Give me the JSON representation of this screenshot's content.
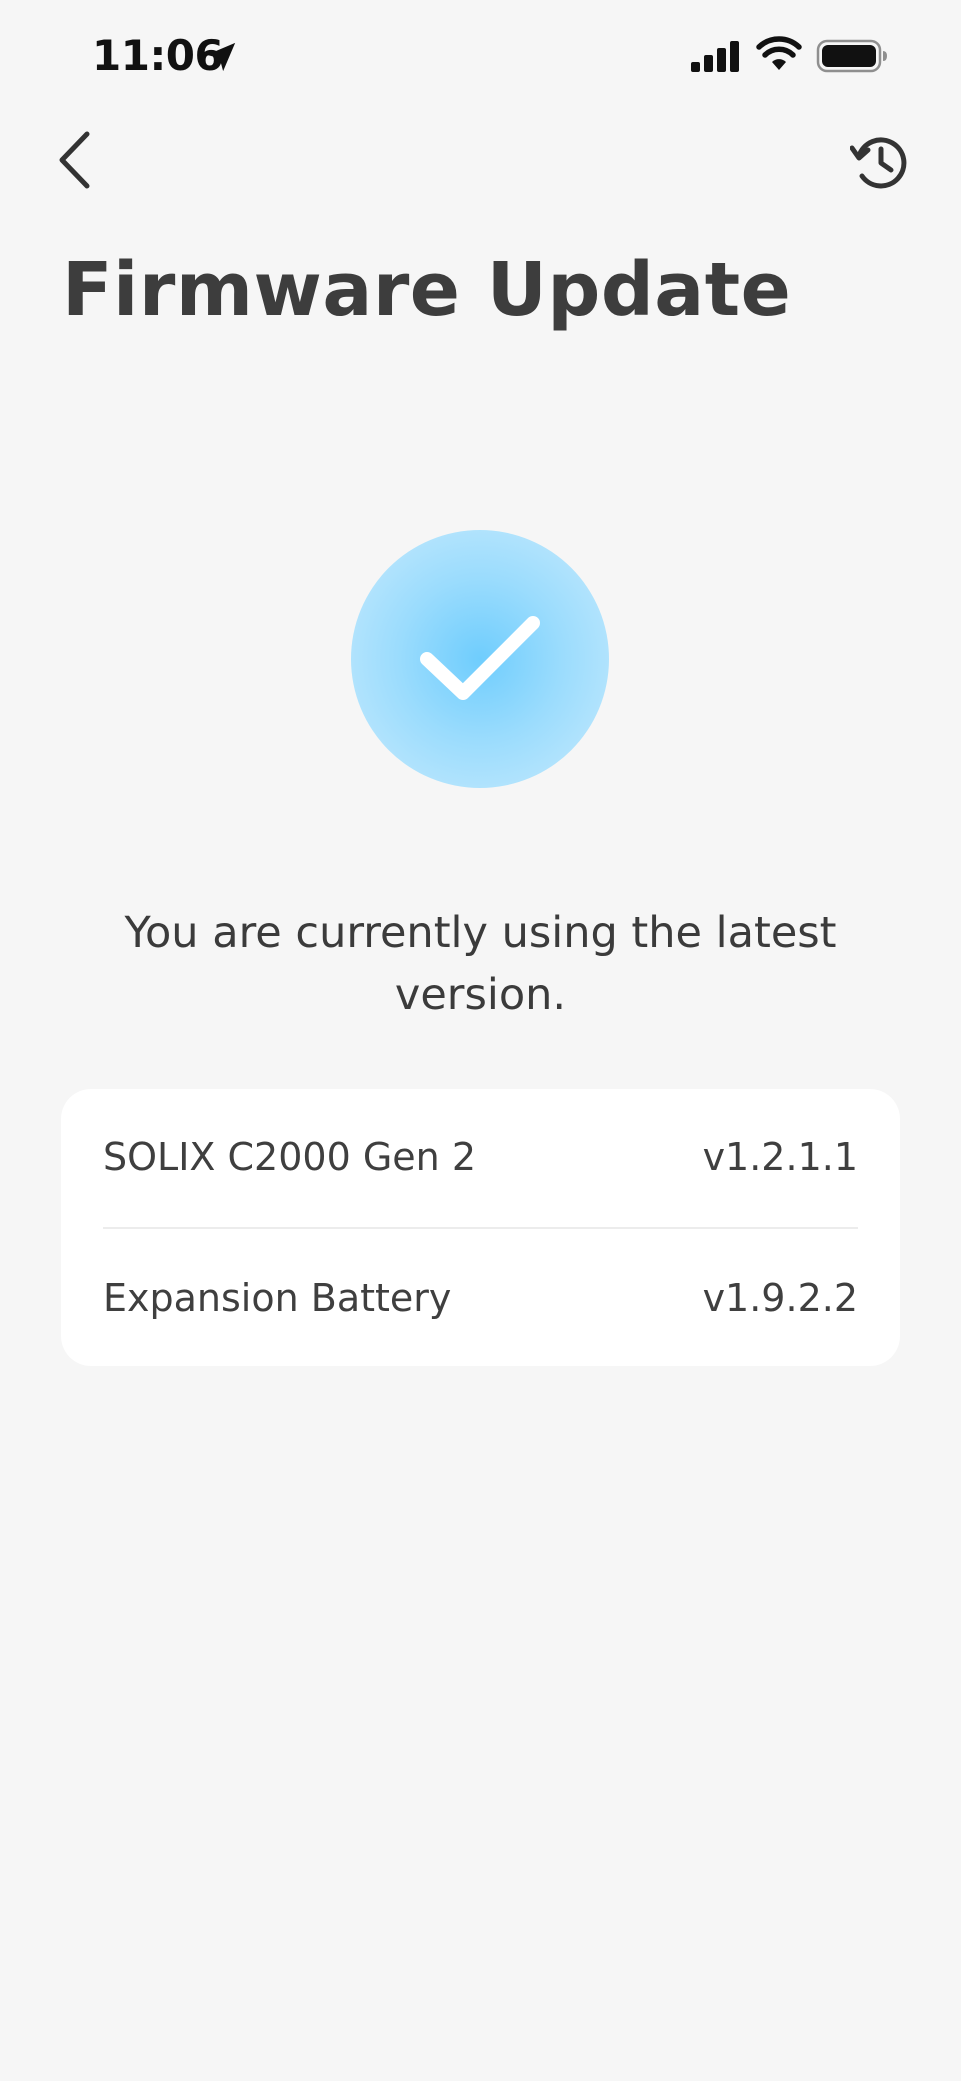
{
  "status_bar": {
    "time": "11:06",
    "location_icon": "location-arrow-icon",
    "signal_icon": "cellular-signal-icon",
    "wifi_icon": "wifi-icon",
    "battery_icon": "battery-icon"
  },
  "nav": {
    "back_icon": "chevron-left-icon",
    "history_icon": "history-clock-icon"
  },
  "page": {
    "title": "Firmware Update",
    "status_message": "You are currently using the latest version."
  },
  "success_badge": {
    "icon": "checkmark-icon",
    "color": "#7fd3fd"
  },
  "devices": [
    {
      "name": "SOLIX C2000 Gen 2",
      "version": "v1.2.1.1"
    },
    {
      "name": "Expansion Battery",
      "version": "v1.9.2.2"
    }
  ],
  "colors": {
    "background": "#f6f6f6",
    "card": "#ffffff",
    "text": "#3f3f3f",
    "accent": "#6fcdfd"
  }
}
